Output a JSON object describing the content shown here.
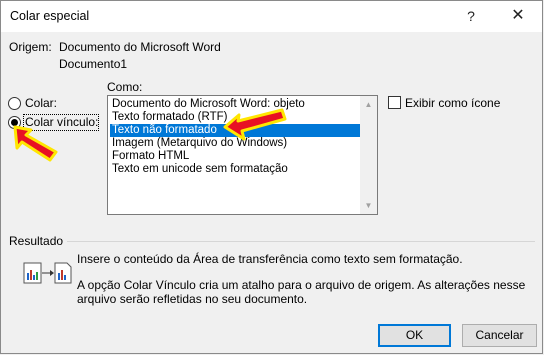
{
  "window": {
    "title": "Colar especial",
    "help_glyph": "?",
    "close_glyph": "✕"
  },
  "origin": {
    "label": "Origem:",
    "line1": "Documento do Microsoft Word",
    "line2": "Documento1"
  },
  "paste_options": {
    "colar_label": "Colar:",
    "colar_vinculo_label": "Colar vínculo:",
    "selected": "Colar vínculo:"
  },
  "como": {
    "label": "Como:",
    "items": [
      "Documento do Microsoft Word: objeto",
      "Texto formatado (RTF)",
      "Texto não formatado",
      "Imagem (Metarquivo do Windows)",
      "Formato HTML",
      "Texto em unicode sem formatação"
    ],
    "selected_index": 2
  },
  "display_icon": {
    "label": "Exibir como ícone",
    "checked": false
  },
  "result": {
    "label": "Resultado",
    "line1": "Insere o conteúdo da Área de transferência como texto sem formatação.",
    "line2": "A opção Colar Vínculo cria um atalho para o arquivo de origem. As alterações nesse",
    "line3": "arquivo serão refletidas no seu documento."
  },
  "buttons": {
    "ok": "OK",
    "cancel": "Cancelar"
  },
  "colors": {
    "selection": "#0078d7",
    "annotation_arrow_fill": "#e81123",
    "annotation_arrow_outline": "#ffe600"
  }
}
